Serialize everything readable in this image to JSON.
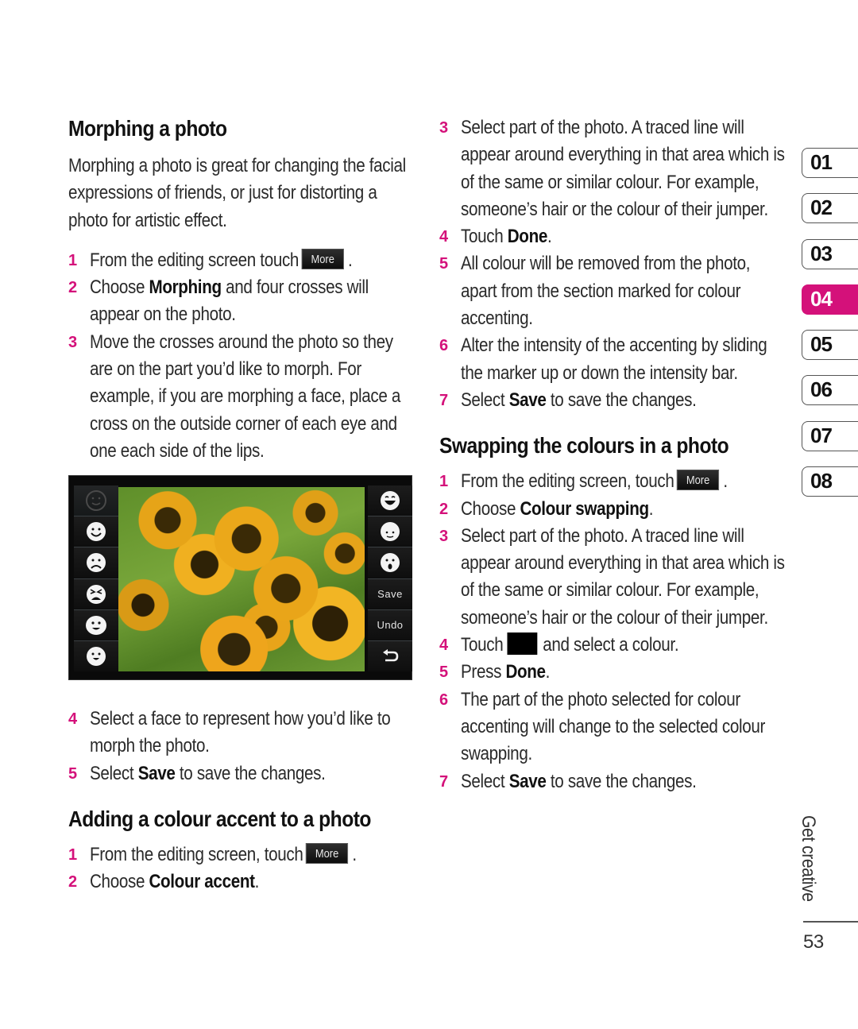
{
  "colors": {
    "accent": "#d4117a",
    "text": "#2a2a2a",
    "button_bg": "#1a1a1a"
  },
  "left_column": {
    "morphing": {
      "title": "Morphing a photo",
      "intro": "Morphing a photo is great for changing the facial expressions of friends, or just for distorting a photo for artistic effect.",
      "steps": [
        {
          "num": "1",
          "pre": "From the editing screen touch",
          "button": "More",
          "post": "."
        },
        {
          "num": "2",
          "pre": "Choose ",
          "bold": "Morphing",
          "post": " and four crosses will appear on the photo."
        },
        {
          "num": "3",
          "text": "Move the crosses around the photo so they are on the part you’d like to morph. For example, if you are morphing a face, place a cross on the outside corner of each eye and one each side of the lips."
        },
        {
          "num": "4",
          "text": "Select a face to represent how you’d like to morph the photo."
        },
        {
          "num": "5",
          "pre": "Select ",
          "bold": "Save",
          "post": " to save the changes."
        }
      ]
    },
    "phone_screen": {
      "left_faces": [
        "neutral-outline-face-icon",
        "smile-face-icon",
        "sad-face-icon",
        "angry-face-icon",
        "grin-face-icon",
        "open-mouth-face-icon"
      ],
      "right_buttons": [
        {
          "type": "icon",
          "name": "laughing-face-icon"
        },
        {
          "type": "icon",
          "name": "content-face-icon"
        },
        {
          "type": "icon",
          "name": "surprised-face-icon"
        },
        {
          "type": "text",
          "label": "Save"
        },
        {
          "type": "text",
          "label": "Undo"
        },
        {
          "type": "icon",
          "name": "back-arrow-icon"
        }
      ]
    },
    "colour_accent": {
      "title": "Adding a colour accent to a photo",
      "steps": [
        {
          "num": "1",
          "pre": "From the editing screen, touch",
          "button": "More",
          "post": "."
        },
        {
          "num": "2",
          "pre": "Choose ",
          "bold": "Colour accent",
          "post": "."
        }
      ]
    }
  },
  "right_column": {
    "colour_accent_cont": {
      "steps": [
        {
          "num": "3",
          "text": "Select part of the photo. A traced line will appear around everything in that area which is of the same or similar colour. For example, someone’s hair or the colour of their jumper."
        },
        {
          "num": "4",
          "pre": "Touch ",
          "bold": "Done",
          "post": "."
        },
        {
          "num": "5",
          "text": "All colour will be removed from the photo, apart from the section marked for colour accenting."
        },
        {
          "num": "6",
          "text": "Alter the intensity of the accenting by sliding the marker up or down the intensity bar."
        },
        {
          "num": "7",
          "pre": "Select ",
          "bold": "Save",
          "post": " to save the changes."
        }
      ]
    },
    "swapping": {
      "title": "Swapping the colours in a photo",
      "steps": [
        {
          "num": "1",
          "pre": "From the editing screen, touch",
          "button": "More",
          "post": "."
        },
        {
          "num": "2",
          "pre": "Choose ",
          "bold": "Colour swapping",
          "post": "."
        },
        {
          "num": "3",
          "text": "Select part of the photo. A traced line will appear around everything in that area which is of the same or similar colour. For example, someone’s hair or the colour of their jumper."
        },
        {
          "num": "4",
          "pre": "Touch",
          "swatch": true,
          "post": "and select a colour."
        },
        {
          "num": "5",
          "pre": "Press ",
          "bold": "Done",
          "post": "."
        },
        {
          "num": "6",
          "text": "The part of the photo selected for colour accenting will change to the selected colour swapping."
        },
        {
          "num": "7",
          "pre": "Select ",
          "bold": "Save",
          "post": " to save the changes."
        }
      ]
    }
  },
  "chapter_tabs": {
    "items": [
      "01",
      "02",
      "03",
      "04",
      "05",
      "06",
      "07",
      "08"
    ],
    "active": "04"
  },
  "footer": {
    "section_label": "Get creative",
    "page_number": "53"
  }
}
